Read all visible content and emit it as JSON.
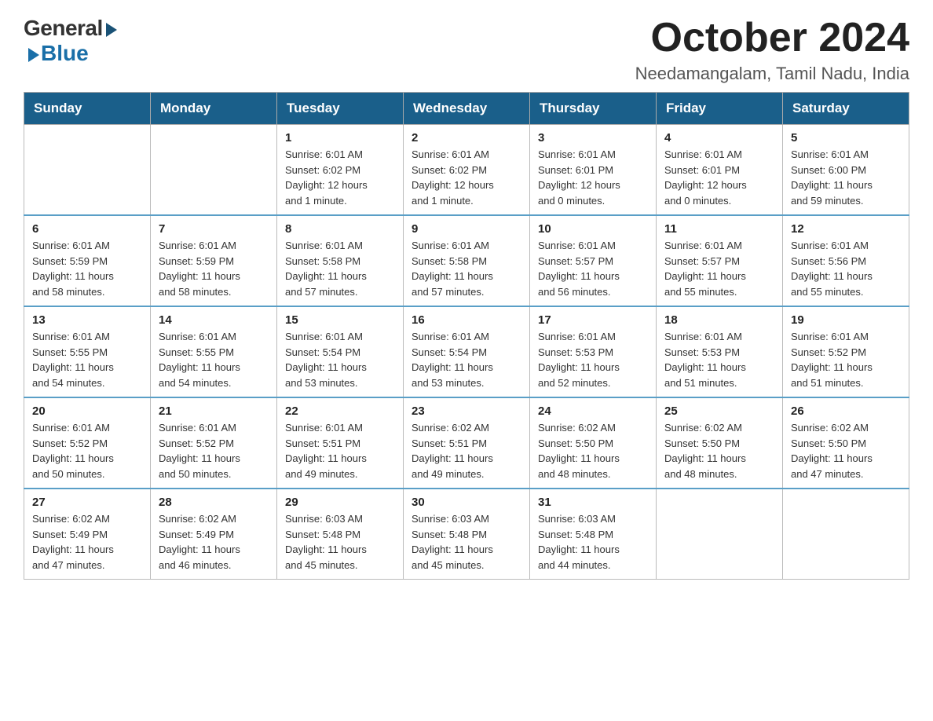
{
  "logo": {
    "general": "General",
    "blue": "Blue"
  },
  "title": "October 2024",
  "subtitle": "Needamangalam, Tamil Nadu, India",
  "days_of_week": [
    "Sunday",
    "Monday",
    "Tuesday",
    "Wednesday",
    "Thursday",
    "Friday",
    "Saturday"
  ],
  "weeks": [
    [
      {
        "day": "",
        "info": ""
      },
      {
        "day": "",
        "info": ""
      },
      {
        "day": "1",
        "info": "Sunrise: 6:01 AM\nSunset: 6:02 PM\nDaylight: 12 hours\nand 1 minute."
      },
      {
        "day": "2",
        "info": "Sunrise: 6:01 AM\nSunset: 6:02 PM\nDaylight: 12 hours\nand 1 minute."
      },
      {
        "day": "3",
        "info": "Sunrise: 6:01 AM\nSunset: 6:01 PM\nDaylight: 12 hours\nand 0 minutes."
      },
      {
        "day": "4",
        "info": "Sunrise: 6:01 AM\nSunset: 6:01 PM\nDaylight: 12 hours\nand 0 minutes."
      },
      {
        "day": "5",
        "info": "Sunrise: 6:01 AM\nSunset: 6:00 PM\nDaylight: 11 hours\nand 59 minutes."
      }
    ],
    [
      {
        "day": "6",
        "info": "Sunrise: 6:01 AM\nSunset: 5:59 PM\nDaylight: 11 hours\nand 58 minutes."
      },
      {
        "day": "7",
        "info": "Sunrise: 6:01 AM\nSunset: 5:59 PM\nDaylight: 11 hours\nand 58 minutes."
      },
      {
        "day": "8",
        "info": "Sunrise: 6:01 AM\nSunset: 5:58 PM\nDaylight: 11 hours\nand 57 minutes."
      },
      {
        "day": "9",
        "info": "Sunrise: 6:01 AM\nSunset: 5:58 PM\nDaylight: 11 hours\nand 57 minutes."
      },
      {
        "day": "10",
        "info": "Sunrise: 6:01 AM\nSunset: 5:57 PM\nDaylight: 11 hours\nand 56 minutes."
      },
      {
        "day": "11",
        "info": "Sunrise: 6:01 AM\nSunset: 5:57 PM\nDaylight: 11 hours\nand 55 minutes."
      },
      {
        "day": "12",
        "info": "Sunrise: 6:01 AM\nSunset: 5:56 PM\nDaylight: 11 hours\nand 55 minutes."
      }
    ],
    [
      {
        "day": "13",
        "info": "Sunrise: 6:01 AM\nSunset: 5:55 PM\nDaylight: 11 hours\nand 54 minutes."
      },
      {
        "day": "14",
        "info": "Sunrise: 6:01 AM\nSunset: 5:55 PM\nDaylight: 11 hours\nand 54 minutes."
      },
      {
        "day": "15",
        "info": "Sunrise: 6:01 AM\nSunset: 5:54 PM\nDaylight: 11 hours\nand 53 minutes."
      },
      {
        "day": "16",
        "info": "Sunrise: 6:01 AM\nSunset: 5:54 PM\nDaylight: 11 hours\nand 53 minutes."
      },
      {
        "day": "17",
        "info": "Sunrise: 6:01 AM\nSunset: 5:53 PM\nDaylight: 11 hours\nand 52 minutes."
      },
      {
        "day": "18",
        "info": "Sunrise: 6:01 AM\nSunset: 5:53 PM\nDaylight: 11 hours\nand 51 minutes."
      },
      {
        "day": "19",
        "info": "Sunrise: 6:01 AM\nSunset: 5:52 PM\nDaylight: 11 hours\nand 51 minutes."
      }
    ],
    [
      {
        "day": "20",
        "info": "Sunrise: 6:01 AM\nSunset: 5:52 PM\nDaylight: 11 hours\nand 50 minutes."
      },
      {
        "day": "21",
        "info": "Sunrise: 6:01 AM\nSunset: 5:52 PM\nDaylight: 11 hours\nand 50 minutes."
      },
      {
        "day": "22",
        "info": "Sunrise: 6:01 AM\nSunset: 5:51 PM\nDaylight: 11 hours\nand 49 minutes."
      },
      {
        "day": "23",
        "info": "Sunrise: 6:02 AM\nSunset: 5:51 PM\nDaylight: 11 hours\nand 49 minutes."
      },
      {
        "day": "24",
        "info": "Sunrise: 6:02 AM\nSunset: 5:50 PM\nDaylight: 11 hours\nand 48 minutes."
      },
      {
        "day": "25",
        "info": "Sunrise: 6:02 AM\nSunset: 5:50 PM\nDaylight: 11 hours\nand 48 minutes."
      },
      {
        "day": "26",
        "info": "Sunrise: 6:02 AM\nSunset: 5:50 PM\nDaylight: 11 hours\nand 47 minutes."
      }
    ],
    [
      {
        "day": "27",
        "info": "Sunrise: 6:02 AM\nSunset: 5:49 PM\nDaylight: 11 hours\nand 47 minutes."
      },
      {
        "day": "28",
        "info": "Sunrise: 6:02 AM\nSunset: 5:49 PM\nDaylight: 11 hours\nand 46 minutes."
      },
      {
        "day": "29",
        "info": "Sunrise: 6:03 AM\nSunset: 5:48 PM\nDaylight: 11 hours\nand 45 minutes."
      },
      {
        "day": "30",
        "info": "Sunrise: 6:03 AM\nSunset: 5:48 PM\nDaylight: 11 hours\nand 45 minutes."
      },
      {
        "day": "31",
        "info": "Sunrise: 6:03 AM\nSunset: 5:48 PM\nDaylight: 11 hours\nand 44 minutes."
      },
      {
        "day": "",
        "info": ""
      },
      {
        "day": "",
        "info": ""
      }
    ]
  ]
}
